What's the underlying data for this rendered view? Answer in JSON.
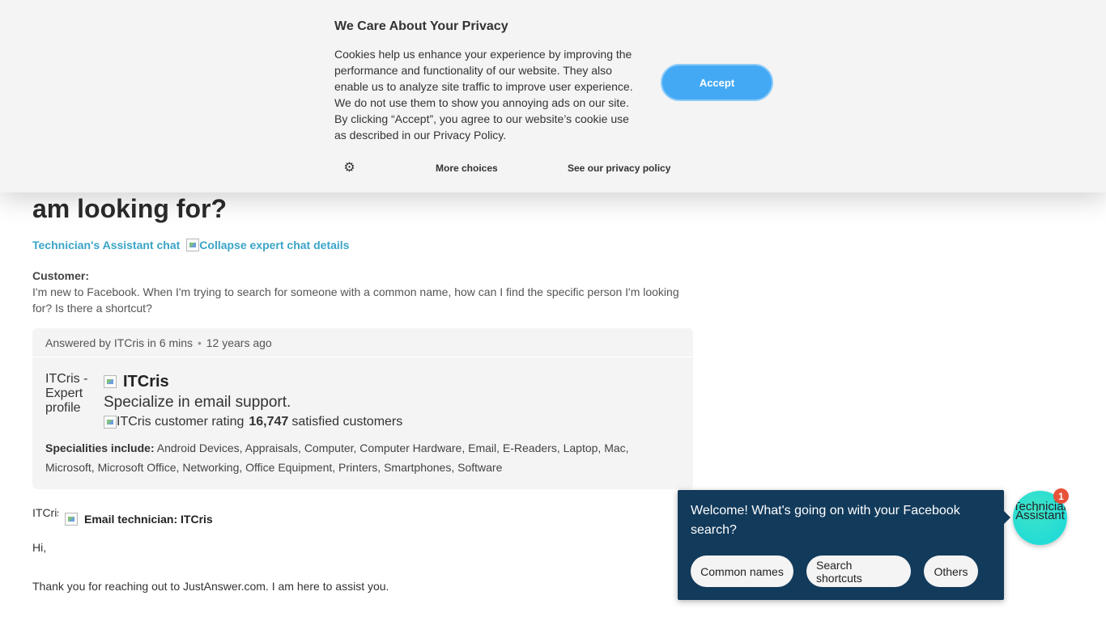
{
  "cookie_banner": {
    "title": "We Care About Your Privacy",
    "body": "Cookies help us enhance your experience by improving the performance and functionality of our website. They also enable us to analyze site traffic to improve user experience. We do not use them to show you annoying ads on our site. By clicking “Accept”, you agree to our website’s cookie use as described in our Privacy Policy.",
    "accept_label": "Accept",
    "more_choices_label": "More choices",
    "privacy_policy_label": "See our privacy policy",
    "settings_icon": "gear-icon",
    "accent_color": "#43a9f5"
  },
  "page": {
    "heading": "am looking for?",
    "chat_link": "Technician's Assistant chat",
    "collapse_label": "Collapse expert chat details",
    "customer_label": "Customer:",
    "customer_question": "I'm new to Facebook. When I'm trying to search for someone with a common name, how can I find the specific person I'm looking for? Is there a shortcut?"
  },
  "answer": {
    "answered_by": "Answered by ITCris in 6 mins",
    "separator": "•",
    "age": "12 years ago",
    "expert": {
      "avatar_alt": "ITCris - Expert profile",
      "name": "ITCris",
      "tagline": "Specialize in email support.",
      "rating_alt": "ITCris customer rating",
      "customers_count": "16,747",
      "customers_label": "satisfied customers"
    },
    "specialities_label": "Specialities include:",
    "specialities": "Android Devices, Appraisals, Computer, Computer Hardware, Email, E-Readers, Laptop, Mac, Microsoft, Microsoft Office, Networking, Office Equipment, Printers, Smartphones, Software"
  },
  "email": {
    "avatar_alt": "ITCris",
    "label": "Email technician: ITCris",
    "greeting": "Hi,",
    "intro": "Thank you for reaching out to JustAnswer.com. I am here to assist you."
  },
  "chat_widget": {
    "message": "Welcome! What's going on with your Facebook search?",
    "options": [
      "Common names",
      "Search shortcuts",
      "Others"
    ],
    "launcher_alt": "Technician's Assistant",
    "badge_count": "1",
    "bubble_color": "#123a5b",
    "launcher_color": "#23dcd6",
    "badge_color": "#e8523a"
  }
}
